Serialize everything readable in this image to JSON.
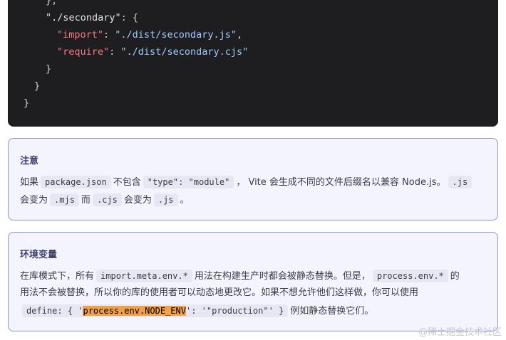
{
  "code": {
    "l1": "},",
    "l2_key": "\"./secondary\"",
    "l2_rest": ": {",
    "l3_key": "\"import\"",
    "l3_sep": ": ",
    "l3_val": "\"./dist/secondary.js\"",
    "l3_end": ",",
    "l4_key": "\"require\"",
    "l4_sep": ": ",
    "l4_val": "\"./dist/secondary.cjs\"",
    "l5": "}",
    "l6": "}",
    "l7": "}"
  },
  "note": {
    "title": "注意",
    "t1": "如果",
    "c1": "package.json",
    "t2": "不包含",
    "c2": "\"type\": \"module\"",
    "t3": "， Vite 会生成不同的文件后缀名以兼容 Node.js。",
    "c3": ".js",
    "t4": "会变为",
    "c4": ".mjs",
    "t5": "而",
    "c5": ".cjs",
    "t6": "会变为",
    "c6": ".js",
    "t7": "。"
  },
  "env": {
    "title": "环境变量",
    "t1": "在库模式下，所有",
    "c1": "import.meta.env.*",
    "t2": "用法在构建生产时都会被静态替换。但是，",
    "c2": "process.env.*",
    "t3": "的",
    "t4": "用法不会被替换，所以你的库的使用者可以动态地更改它。如果不想允许他们这样做，你可以使用",
    "c3a": "define: { '",
    "c3b": "process.env.NODE_ENV",
    "c3c": "': '\"production\"' }",
    "t5": "例如静态替换它们。"
  },
  "watermark": "@稀土掘金技术社区"
}
